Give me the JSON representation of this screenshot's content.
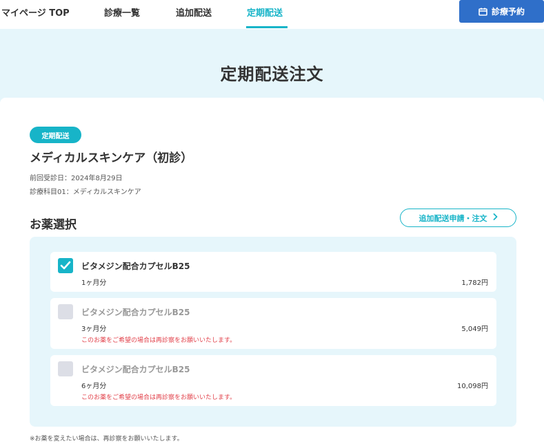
{
  "nav": {
    "tabs": [
      {
        "label": "マイページ TOP"
      },
      {
        "label": "診療一覧"
      },
      {
        "label": "追加配送"
      },
      {
        "label": "定期配送"
      }
    ],
    "active_index": 3,
    "reserve_label": "診療予約",
    "reserve_icon": "calendar-icon"
  },
  "page": {
    "title": "定期配送注文"
  },
  "course": {
    "badge": "定期配送",
    "title": "メディカルスキンケア（初診）",
    "last_visit": "前回受診日：2024年8月29日",
    "department": "診療科目01：メディカルスキンケア"
  },
  "medicine_section": {
    "title": "お薬選択",
    "add_order_label": "追加配送申請・注文",
    "add_order_icon": "chevron-right-icon",
    "items": [
      {
        "name": "ビタメジン配合カプセルB25",
        "period": "1ヶ月分",
        "price": "1,782円",
        "checked": true,
        "warning": ""
      },
      {
        "name": "ビタメジン配合カプセルB25",
        "period": "3ヶ月分",
        "price": "5,049円",
        "checked": false,
        "warning": "このお薬をご希望の場合は再診察をお願いいたします。"
      },
      {
        "name": "ビタメジン配合カプセルB25",
        "period": "6ヶ月分",
        "price": "10,098円",
        "checked": false,
        "warning": "このお薬をご希望の場合は再診察をお願いいたします。"
      }
    ]
  },
  "footnote": "※お薬を変えたい場合は、再診察をお願いいたします。",
  "colors": {
    "accent": "#17b4c8",
    "primary_button": "#2f6fc9",
    "hero_bg": "#e6f6fb",
    "warning": "#e2424b"
  }
}
